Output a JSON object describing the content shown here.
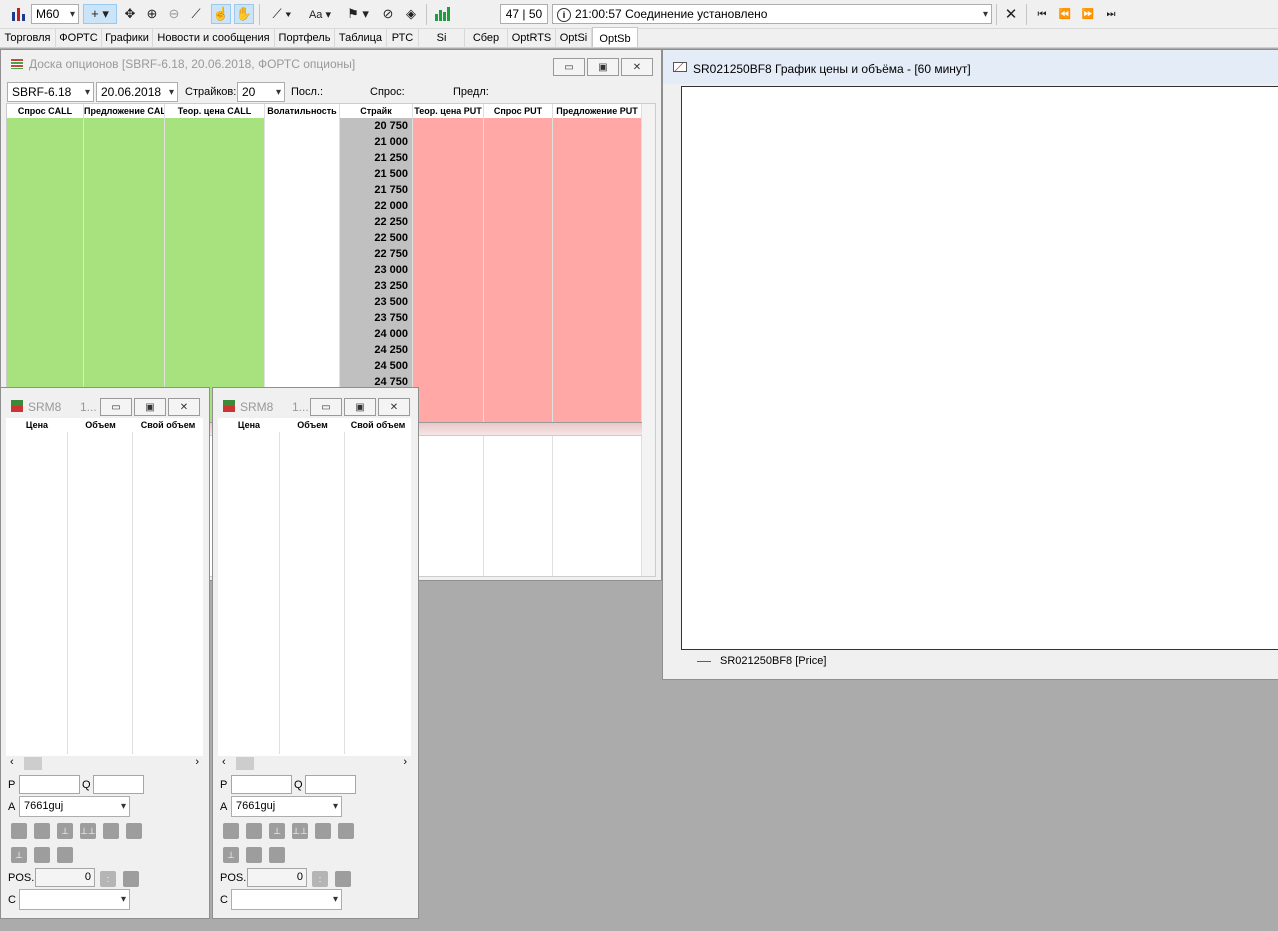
{
  "toolbar": {
    "timeframe": "M60",
    "counter": "47 | 50",
    "status_time": "21:00:57",
    "status_text": "Соединение установлено",
    "icons": [
      "bar-chart-icon",
      "crosshair-icon",
      "move-icon",
      "zoom-in-icon",
      "zoom-out-icon",
      "ruler-icon",
      "hand-pointer-icon",
      "hand-icon",
      "line-icon",
      "text-icon",
      "marker-icon",
      "hide-icon",
      "layers-icon",
      "green-chart-icon",
      "close-x-icon",
      "first-icon",
      "prev-icon",
      "next-icon",
      "last-icon"
    ]
  },
  "tabs": [
    "Торговля",
    "ФОРТС",
    "Графики",
    "Новости и сообщения",
    "Портфель",
    "Таблица",
    "РТС",
    "Si",
    "Сбер",
    "OptRTS",
    "OptSi",
    "OptSb"
  ],
  "active_tab": "OptSb",
  "options_board": {
    "title": "Доска опционов [SBRF-6.18, 20.06.2018, ФОРТС опционы]",
    "instrument": "SBRF-6.18",
    "date": "20.06.2018",
    "strikes_label": "Страйков:",
    "strikes_value": "20",
    "last_label": "Посл.:",
    "bid_label": "Спрос:",
    "ask_label": "Предл:",
    "columns": [
      "Спрос CALL",
      "Предложение CALL",
      "Теор. цена CALL",
      "Волатильность",
      "Страйк",
      "Теор. цена PUT",
      "Спрос PUT",
      "Предложение PUT"
    ],
    "strikes": [
      "20 750",
      "21 000",
      "21 250",
      "21 500",
      "21 750",
      "22 000",
      "22 250",
      "22 500",
      "22 750",
      "23 000",
      "23 250",
      "23 500",
      "23 750",
      "24 000",
      "24 250",
      "24 500",
      "24 750"
    ],
    "colors": {
      "call": "#a8e27f",
      "put": "#ffa8a5",
      "strike": "#c0c0c0"
    }
  },
  "chart_window": {
    "title": "SR021250BF8 График цены и объёма - [60 минут]",
    "legend": "SR021250BF8 [Price]",
    "legend_color": "#d03030"
  },
  "order_windows": [
    {
      "title": "SRM8",
      "suffix": "1...",
      "columns": [
        "Цена",
        "Объем",
        "Свой объем"
      ],
      "p_label": "P",
      "q_label": "Q",
      "a_label": "A",
      "account": "7661guj",
      "pos_label": "POS.",
      "pos_value": "0",
      "c_label": "C"
    },
    {
      "title": "SRM8",
      "suffix": "1...",
      "columns": [
        "Цена",
        "Объем",
        "Свой объем"
      ],
      "p_label": "P",
      "q_label": "Q",
      "a_label": "A",
      "account": "7661guj",
      "pos_label": "POS.",
      "pos_value": "0",
      "c_label": "C"
    }
  ]
}
